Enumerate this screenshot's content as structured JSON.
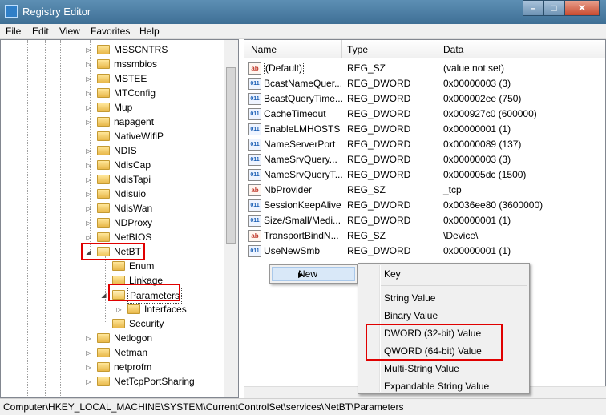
{
  "window": {
    "title": "Registry Editor",
    "controls": {
      "minimize": "–",
      "maximize": "□",
      "close": "✕"
    }
  },
  "menubar": [
    "File",
    "Edit",
    "View",
    "Favorites",
    "Help"
  ],
  "tree": {
    "nodes": [
      {
        "label": "MSSCNTRS"
      },
      {
        "label": "mssmbios"
      },
      {
        "label": "MSTEE"
      },
      {
        "label": "MTConfig"
      },
      {
        "label": "Mup"
      },
      {
        "label": "napagent"
      },
      {
        "label": "NativeWifiP"
      },
      {
        "label": "NDIS"
      },
      {
        "label": "NdisCap"
      },
      {
        "label": "NdisTapi"
      },
      {
        "label": "Ndisuio"
      },
      {
        "label": "NdisWan"
      },
      {
        "label": "NDProxy"
      },
      {
        "label": "NetBIOS"
      },
      {
        "label": "NetBT"
      },
      {
        "label": "Enum"
      },
      {
        "label": "Linkage"
      },
      {
        "label": "Parameters"
      },
      {
        "label": "Interfaces"
      },
      {
        "label": "Security"
      },
      {
        "label": "Netlogon"
      },
      {
        "label": "Netman"
      },
      {
        "label": "netprofm"
      },
      {
        "label": "NetTcpPortSharing"
      }
    ]
  },
  "values_pane": {
    "columns": [
      "Name",
      "Type",
      "Data"
    ],
    "rows": [
      {
        "icon": "string-value-icon",
        "glyph": "ab",
        "name": "(Default)",
        "type": "REG_SZ",
        "data": "(value not set)"
      },
      {
        "icon": "binary-value-icon",
        "glyph": "011",
        "name": "BcastNameQuer...",
        "type": "REG_DWORD",
        "data": "0x00000003 (3)"
      },
      {
        "icon": "binary-value-icon",
        "glyph": "011",
        "name": "BcastQueryTime...",
        "type": "REG_DWORD",
        "data": "0x000002ee (750)"
      },
      {
        "icon": "binary-value-icon",
        "glyph": "011",
        "name": "CacheTimeout",
        "type": "REG_DWORD",
        "data": "0x000927c0 (600000)"
      },
      {
        "icon": "binary-value-icon",
        "glyph": "011",
        "name": "EnableLMHOSTS",
        "type": "REG_DWORD",
        "data": "0x00000001 (1)"
      },
      {
        "icon": "binary-value-icon",
        "glyph": "011",
        "name": "NameServerPort",
        "type": "REG_DWORD",
        "data": "0x00000089 (137)"
      },
      {
        "icon": "binary-value-icon",
        "glyph": "011",
        "name": "NameSrvQuery...",
        "type": "REG_DWORD",
        "data": "0x00000003 (3)"
      },
      {
        "icon": "binary-value-icon",
        "glyph": "011",
        "name": "NameSrvQueryT...",
        "type": "REG_DWORD",
        "data": "0x000005dc (1500)"
      },
      {
        "icon": "string-value-icon",
        "glyph": "ab",
        "name": "NbProvider",
        "type": "REG_SZ",
        "data": "_tcp"
      },
      {
        "icon": "binary-value-icon",
        "glyph": "011",
        "name": "SessionKeepAlive",
        "type": "REG_DWORD",
        "data": "0x0036ee80 (3600000)"
      },
      {
        "icon": "binary-value-icon",
        "glyph": "011",
        "name": "Size/Small/Medi...",
        "type": "REG_DWORD",
        "data": "0x00000001 (1)"
      },
      {
        "icon": "string-value-icon",
        "glyph": "ab",
        "name": "TransportBindN...",
        "type": "REG_SZ",
        "data": "\\Device\\"
      },
      {
        "icon": "binary-value-icon",
        "glyph": "011",
        "name": "UseNewSmb",
        "type": "REG_DWORD",
        "data": "0x00000001 (1)"
      }
    ]
  },
  "context_menu": {
    "new_label": "New",
    "submenu": {
      "key": "Key",
      "string_value": "String Value",
      "binary_value": "Binary Value",
      "dword_value": "DWORD (32-bit) Value",
      "qword_value": "QWORD (64-bit) Value",
      "multi_string_value": "Multi-String Value",
      "expandable_string_value": "Expandable String Value"
    }
  },
  "statusbar": {
    "path": "Computer\\HKEY_LOCAL_MACHINE\\SYSTEM\\CurrentControlSet\\services\\NetBT\\Parameters"
  },
  "colors": {
    "highlight_box": "#e00000",
    "titlebar": "#4f7fa5"
  }
}
